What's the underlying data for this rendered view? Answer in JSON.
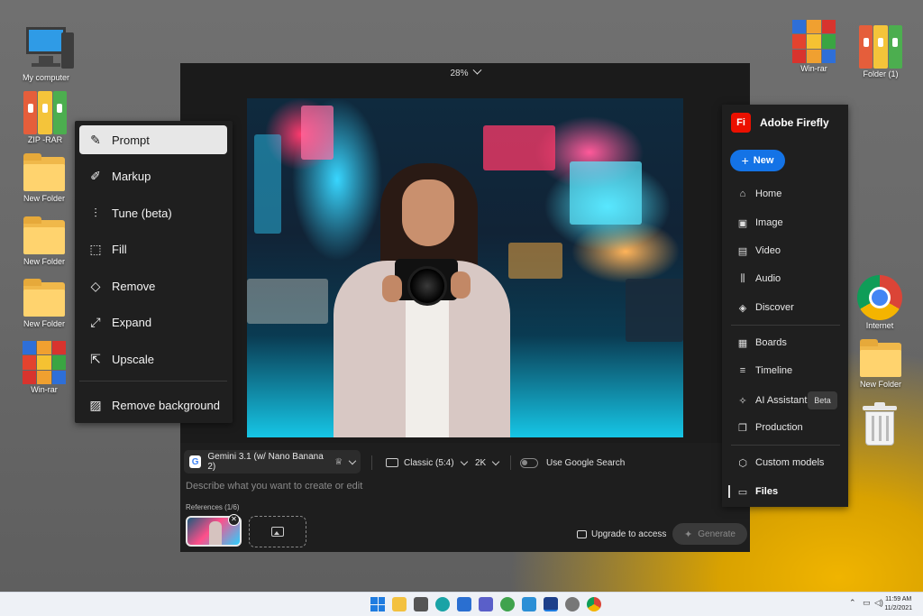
{
  "desktop": {
    "icons": [
      {
        "label": "My computer"
      },
      {
        "label": "ZIP -RAR"
      },
      {
        "label": "New Folder"
      },
      {
        "label": "New Folder"
      },
      {
        "label": "New Folder"
      },
      {
        "label": "Win-rar"
      },
      {
        "label": "Win-rar"
      },
      {
        "label": "Folder (1)"
      },
      {
        "label": "Internet"
      },
      {
        "label": "New Folder"
      }
    ]
  },
  "canvas": {
    "zoom": "28%"
  },
  "tools": {
    "items": [
      {
        "label": "Prompt",
        "icon": "prompt-icon",
        "active": true
      },
      {
        "label": "Markup",
        "icon": "markup-icon"
      },
      {
        "label": "Tune (beta)",
        "icon": "tune-icon"
      },
      {
        "label": "Fill",
        "icon": "fill-icon"
      },
      {
        "label": "Remove",
        "icon": "remove-icon"
      },
      {
        "label": "Expand",
        "icon": "expand-icon"
      },
      {
        "label": "Upscale",
        "icon": "upscale-icon"
      },
      {
        "label": "Remove background",
        "icon": "remove-background-icon"
      }
    ]
  },
  "prompt_bar": {
    "model": "Gemini 3.1 (w/ Nano Banana 2)",
    "aspect_ratio": "Classic (5:4)",
    "resolution": "2K",
    "google_search_label": "Use Google Search",
    "prompt_placeholder": "Describe what you want to create or edit",
    "references_label": "References (1/6)",
    "upgrade_label": "Upgrade to access",
    "generate_label": "Generate"
  },
  "nav": {
    "brand_logo": "Fi",
    "brand_name": "Adobe Firefly",
    "new_label": "New",
    "items": [
      {
        "label": "Home",
        "icon": "home-icon"
      },
      {
        "label": "Image",
        "icon": "image-icon"
      },
      {
        "label": "Video",
        "icon": "video-icon"
      },
      {
        "label": "Audio",
        "icon": "audio-icon"
      },
      {
        "label": "Discover",
        "icon": "discover-icon"
      },
      {
        "label": "Boards",
        "icon": "boards-icon"
      },
      {
        "label": "Timeline",
        "icon": "timeline-icon"
      },
      {
        "label": "AI Assistant",
        "icon": "ai-assistant-icon"
      },
      {
        "label": "Production",
        "icon": "production-icon"
      },
      {
        "label": "Custom models",
        "icon": "custom-models-icon"
      },
      {
        "label": "Files",
        "icon": "files-icon"
      }
    ],
    "beta_badge": "Beta"
  },
  "taskbar": {
    "clock_time": "11:59 AM",
    "clock_date": "11/2/2021"
  },
  "colors": {
    "accent_blue": "#1473e6",
    "adobe_red": "#eb1000",
    "panel_bg": "#1f1f1f"
  }
}
